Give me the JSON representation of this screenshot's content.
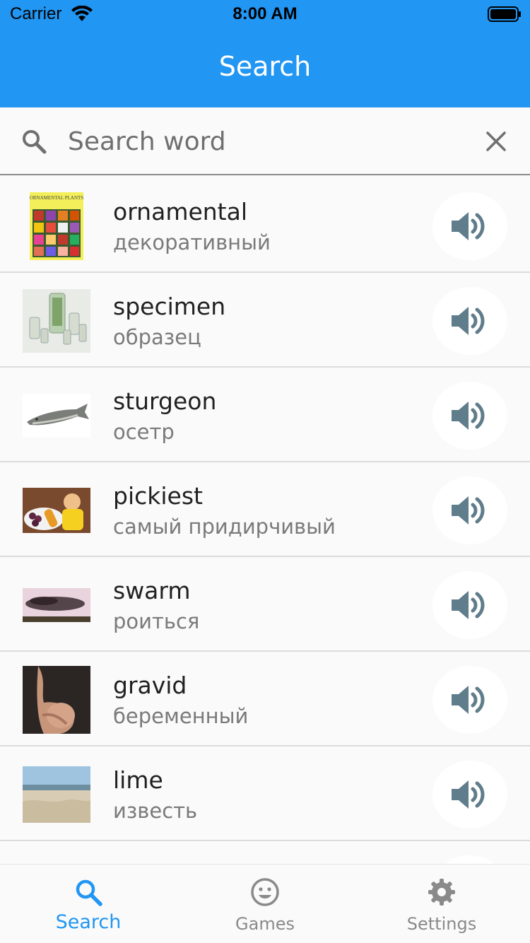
{
  "status_bar": {
    "carrier": "Carrier",
    "time": "8:00 AM"
  },
  "app_bar": {
    "title": "Search"
  },
  "search": {
    "placeholder": "Search word",
    "value": ""
  },
  "words": [
    {
      "word": "ornamental",
      "translation": "декоративный",
      "image": "ornamental-plants-book-cover"
    },
    {
      "word": "specimen",
      "translation": "образец",
      "image": "specimen-jars"
    },
    {
      "word": "sturgeon",
      "translation": "осетр",
      "image": "sturgeon-fish"
    },
    {
      "word": "pickiest",
      "translation": "самый придирчивый",
      "image": "child-with-food"
    },
    {
      "word": "swarm",
      "translation": "роиться",
      "image": "bird-swarm"
    },
    {
      "word": "gravid",
      "translation": "беременный",
      "image": "pregnant-woman"
    },
    {
      "word": "lime",
      "translation": "известь",
      "image": "lime-quarry"
    }
  ],
  "thumb_text": {
    "ornamental_cover": "ORNAMENTAL PLANTS"
  },
  "bottom_nav": {
    "items": [
      {
        "label": "Search",
        "icon": "search-icon",
        "active": true
      },
      {
        "label": "Games",
        "icon": "smiley-icon",
        "active": false
      },
      {
        "label": "Settings",
        "icon": "gear-icon",
        "active": false
      }
    ]
  },
  "colors": {
    "primary": "#2196f3",
    "speaker": "#607d8b",
    "inactive": "#8a8a8a"
  }
}
